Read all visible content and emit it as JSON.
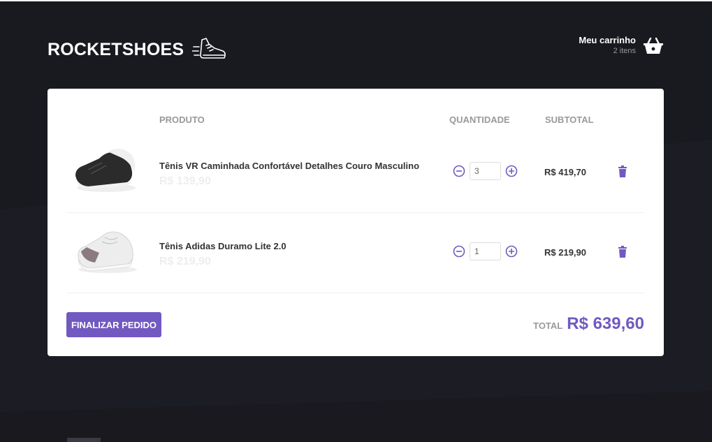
{
  "header": {
    "logo_text": "ROCKETSHOES",
    "cart_title": "Meu carrinho",
    "cart_count": "2 itens"
  },
  "table": {
    "headers": {
      "product": "PRODUTO",
      "quantity": "QUANTIDADE",
      "subtotal": "SUBTOTAL"
    },
    "items": [
      {
        "title": "Tênis VR Caminhada Confortável Detalhes Couro Masculino",
        "price": "R$ 139,90",
        "quantity": "3",
        "subtotal": "R$ 419,70",
        "image": "black-sneaker-image"
      },
      {
        "title": "Tênis Adidas Duramo Lite 2.0",
        "price": "R$ 219,90",
        "quantity": "1",
        "subtotal": "R$ 219,90",
        "image": "white-sneaker-image"
      }
    ]
  },
  "footer": {
    "checkout_label": "FINALIZAR PEDIDO",
    "total_label": "TOTAL",
    "total_value": "R$ 639,60"
  },
  "colors": {
    "background": "#191920",
    "accent": "#7159c1",
    "card": "#ffffff"
  }
}
